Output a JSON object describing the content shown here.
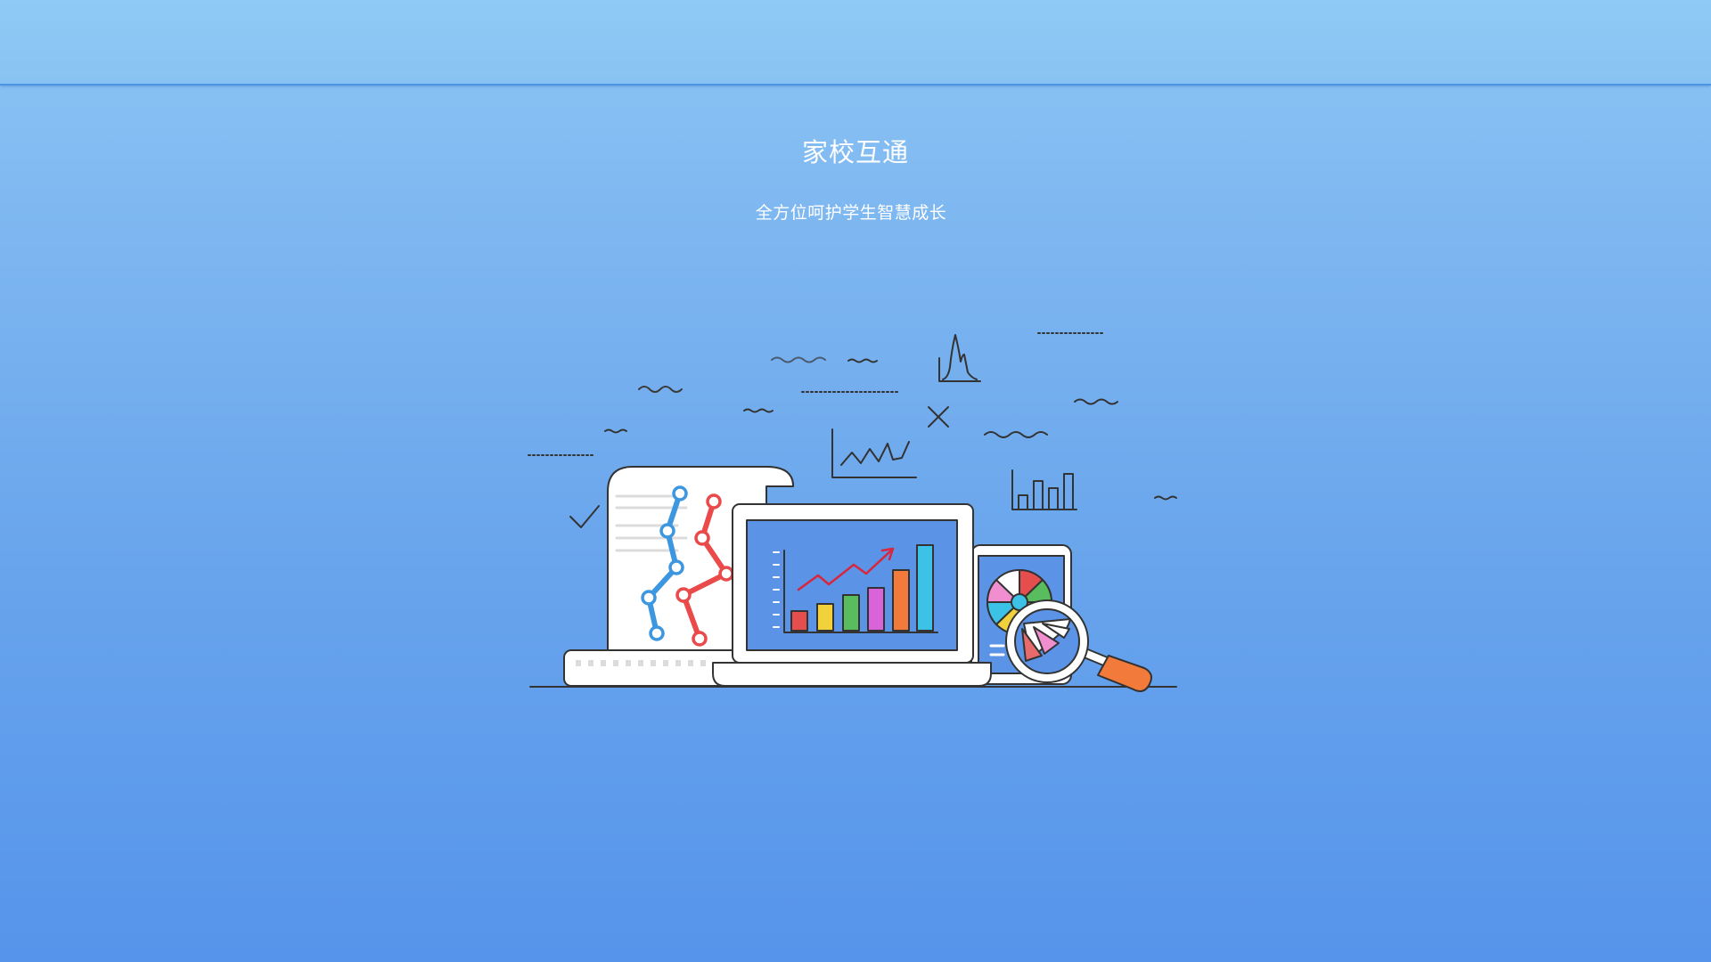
{
  "header": {
    "title": "家校互通",
    "subtitle": "全方位呵护学生智慧成长"
  },
  "colors": {
    "accent": "#5694eb",
    "topbar": "#8cc6f4",
    "text": "#ffffff",
    "outline": "#333333"
  },
  "illustration": {
    "icons": [
      "document-line-chart-icon",
      "laptop-bar-chart-icon",
      "tablet-pie-chart-icon",
      "magnifier-icon",
      "line-chart-icon",
      "bar-chart-icon",
      "peak-chart-icon",
      "checkmark-icon",
      "cross-icon"
    ]
  }
}
